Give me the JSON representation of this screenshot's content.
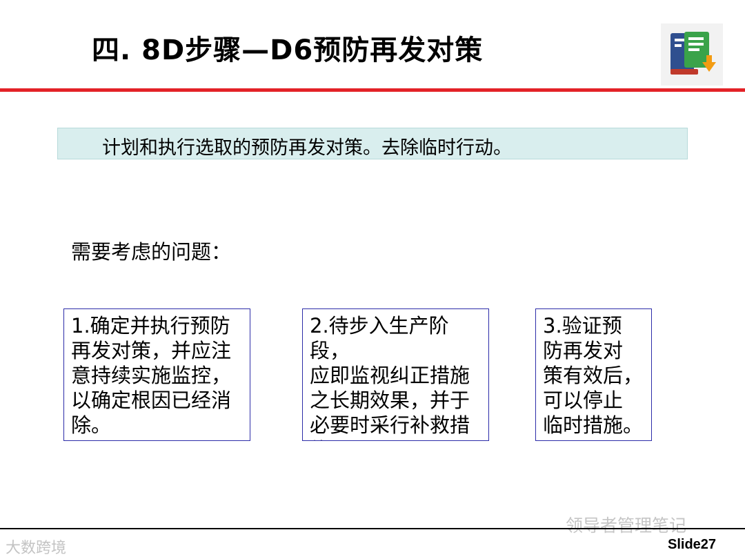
{
  "header": {
    "title": "四.  8D步骤—D6预防再发对策",
    "logo_icon": "book-document-icon"
  },
  "banner": {
    "text": "计划和执行选取的预防再发对策。去除临时行动。"
  },
  "subheading": "需要考虑的问题：",
  "boxes": [
    {
      "text": "1.确定并执行预防\n再发对策，并应注\n意持续实施监控，\n以确定根因已经消\n除。"
    },
    {
      "text": "2.待步入生产阶段，\n应即监视纠正措施\n之长期效果，并于\n必要时采行补救措\n施。"
    },
    {
      "text": " 3.验证预\n防再发对\n策有效后，\n可以停止\n临时措施。"
    }
  ],
  "footer": {
    "watermark_right": "领导者管理笔记",
    "watermark_left": "大数跨境",
    "slide_number": "Slide27"
  },
  "colors": {
    "accent_red": "#e32227",
    "banner_bg": "#d9eeee",
    "box_border": "#2b2ba8"
  }
}
